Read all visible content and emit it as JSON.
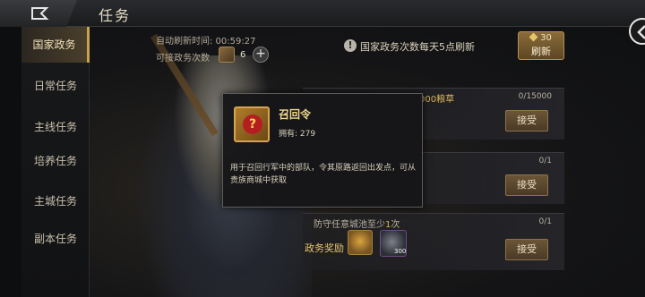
{
  "header": {
    "title": "任务"
  },
  "sidebar": {
    "items": [
      {
        "label": "国家政务"
      },
      {
        "label": "日常任务"
      },
      {
        "label": "主线任务"
      },
      {
        "label": "培养任务"
      },
      {
        "label": "主城任务"
      },
      {
        "label": "副本任务"
      }
    ]
  },
  "status": {
    "auto_refresh": "自动刷新时间:  00:59:27",
    "accept_count_label": "可接政务次数",
    "accept_count_value": "6",
    "plus": "+",
    "daily_note": "国家政务次数每天5点刷新",
    "info": "!"
  },
  "refresh": {
    "cost": "30",
    "label": "刷新"
  },
  "tasks": [
    {
      "name_prefix": "",
      "name_highlight": "000粮草",
      "progress": "0/15000",
      "button": "接受"
    },
    {
      "progress": "0/1",
      "button": "接受"
    },
    {
      "name_prefix": "防守任意城池至少",
      "name_highlight": "1",
      "name_suffix": "次",
      "progress": "0/1",
      "button": "接受",
      "reward_label": "政务奖励",
      "reward_qty": "300"
    }
  ],
  "popup": {
    "item_name": "召回令",
    "own_label": "拥有:",
    "own_value": "279",
    "description": "用于召回行军中的部队，令其原路返回出发点，可从贵族商城中获取",
    "icon_glyph": "?"
  },
  "colors": {
    "accent_gold": "#c9a24e",
    "highlight": "#d8b45a"
  }
}
